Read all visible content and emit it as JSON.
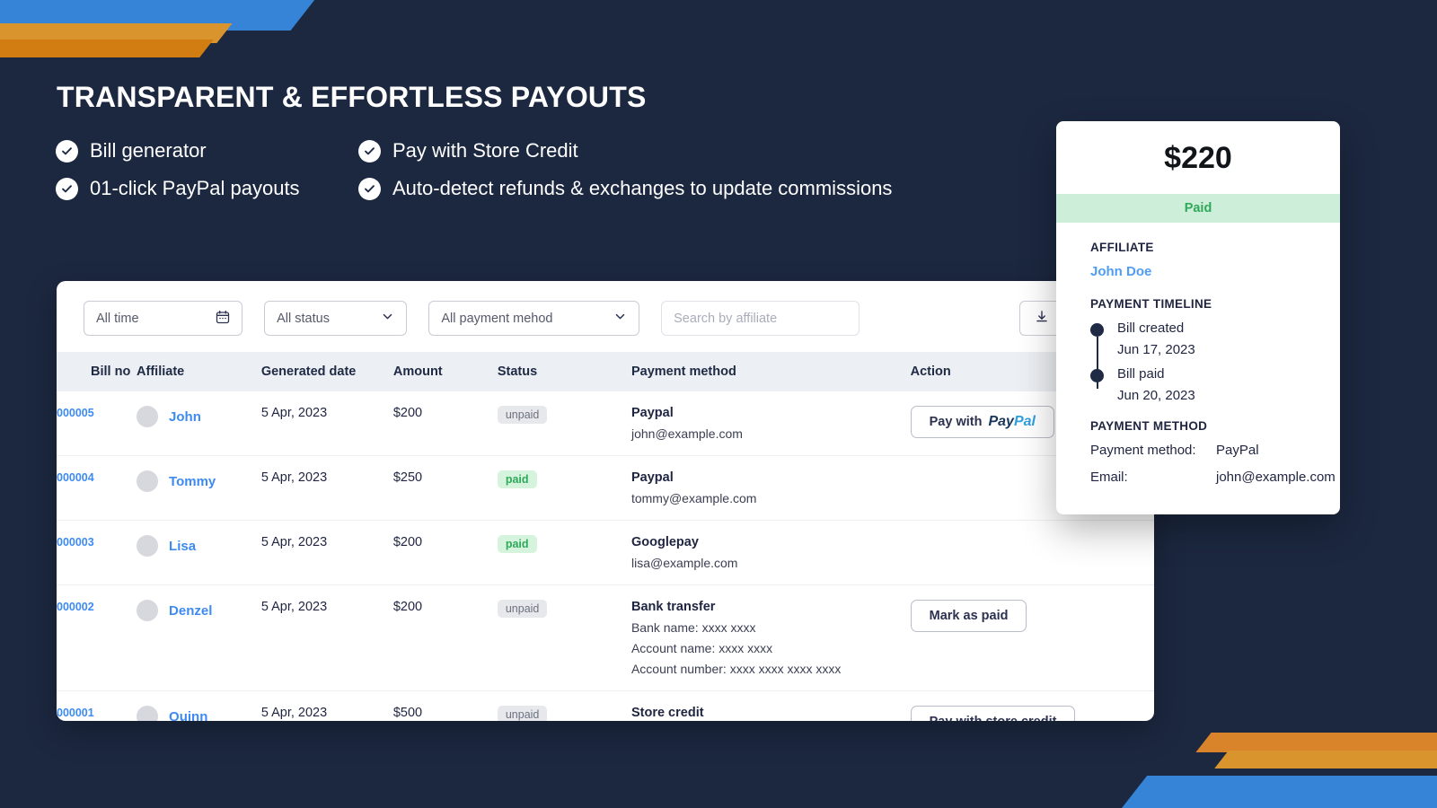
{
  "hero": {
    "title": "TRANSPARENT & EFFORTLESS PAYOUTS",
    "features": [
      "Bill generator",
      "Pay with Store Credit",
      "01-click PayPal payouts",
      "Auto-detect refunds & exchanges to update commissions"
    ]
  },
  "filters": {
    "time": "All time",
    "status": "All status",
    "method": "All payment mehod",
    "search_placeholder": "Search by affiliate",
    "search_value": "",
    "export_label": "Export"
  },
  "table": {
    "columns": [
      "Bill no",
      "Affiliate",
      "Generated date",
      "Amount",
      "Status",
      "Payment method",
      "Action"
    ],
    "rows": [
      {
        "bill_no": "000005",
        "affiliate": "John",
        "date": "5 Apr, 2023",
        "amount": "$200",
        "status": "unpaid",
        "method_title": "Paypal",
        "method_lines": [
          "john@example.com"
        ],
        "action": "Pay with",
        "action_type": "paypal"
      },
      {
        "bill_no": "000004",
        "affiliate": "Tommy",
        "date": "5 Apr, 2023",
        "amount": "$250",
        "status": "paid",
        "method_title": "Paypal",
        "method_lines": [
          "tommy@example.com"
        ],
        "action": "",
        "action_type": "none"
      },
      {
        "bill_no": "000003",
        "affiliate": "Lisa",
        "date": "5 Apr, 2023",
        "amount": "$200",
        "status": "paid",
        "method_title": "Googlepay",
        "method_lines": [
          "lisa@example.com"
        ],
        "action": "",
        "action_type": "none"
      },
      {
        "bill_no": "000002",
        "affiliate": "Denzel",
        "date": "5 Apr, 2023",
        "amount": "$200",
        "status": "unpaid",
        "method_title": "Bank transfer",
        "method_lines": [
          "Bank name: xxxx xxxx",
          "Account name: xxxx xxxx",
          "Account number: xxxx xxxx xxxx xxxx"
        ],
        "action": "Mark as paid",
        "action_type": "text"
      },
      {
        "bill_no": "000001",
        "affiliate": "Quinn",
        "date": "5 Apr, 2023",
        "amount": "$500",
        "status": "unpaid",
        "method_title": "Store credit",
        "method_lines": [],
        "action": "Pay with store credit",
        "action_type": "text"
      }
    ]
  },
  "detail": {
    "amount": "$220",
    "status": "Paid",
    "affiliate_label": "AFFILIATE",
    "affiliate_name": "John Doe",
    "timeline_label": "PAYMENT TIMELINE",
    "timeline": [
      {
        "title": "Bill created",
        "date": "Jun 17, 2023"
      },
      {
        "title": "Bill paid",
        "date": "Jun 20, 2023"
      }
    ],
    "method_label": "PAYMENT METHOD",
    "method_rows": [
      {
        "key": "Payment method:",
        "value": "PayPal"
      },
      {
        "key": "Email:",
        "value": "john@example.com"
      }
    ]
  },
  "colors": {
    "background": "#1c2840",
    "accent_blue": "#3584d8",
    "accent_orange_light": "#d9942e",
    "accent_orange_dark": "#d17d12",
    "link_blue": "#3d8bf2",
    "paid_green": "#2fa85a",
    "paid_bg": "#d5f3dd",
    "unpaid_bg": "#e6e8ec",
    "unpaid_text": "#6d7280"
  }
}
